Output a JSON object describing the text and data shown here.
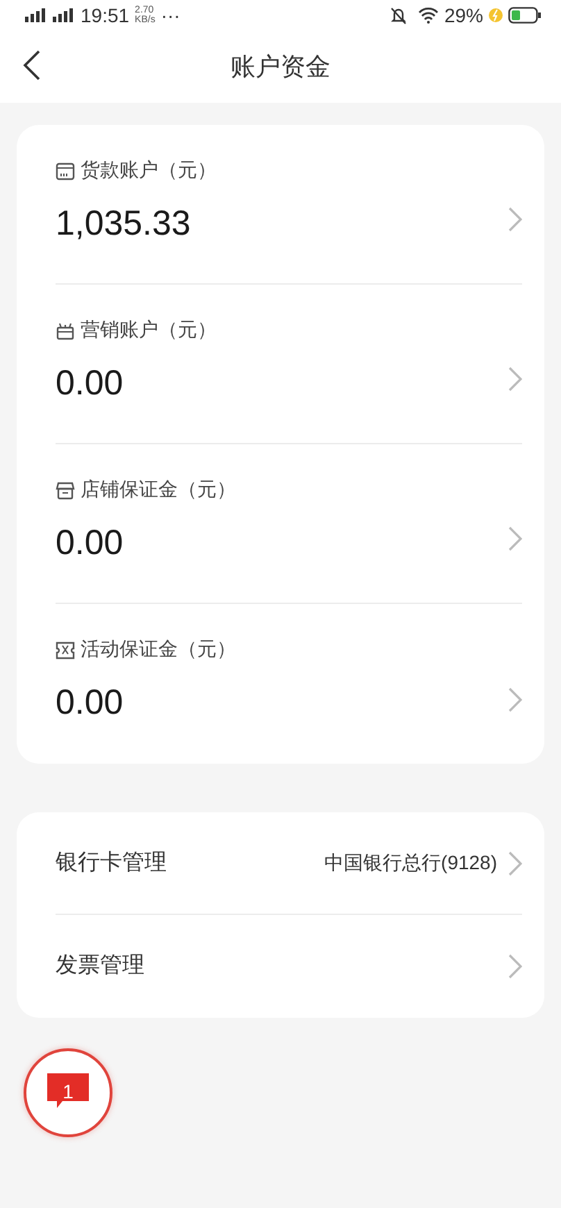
{
  "status_bar": {
    "time": "19:51",
    "speed_value": "2.70",
    "speed_unit": "KB/s",
    "more": "···",
    "battery": "29%"
  },
  "header": {
    "title": "账户资金"
  },
  "accounts": [
    {
      "kind": "wallet",
      "label": "货款账户（元）",
      "amount": "1,035.33"
    },
    {
      "kind": "gift",
      "label": "营销账户（元）",
      "amount": "0.00"
    },
    {
      "kind": "store",
      "label": "店铺保证金（元）",
      "amount": "0.00"
    },
    {
      "kind": "ticket",
      "label": "活动保证金（元）",
      "amount": "0.00"
    }
  ],
  "settings": [
    {
      "label": "银行卡管理",
      "value": "中国银行总行(9128)"
    },
    {
      "label": "发票管理"
    }
  ],
  "message_button": {
    "count": "1"
  }
}
